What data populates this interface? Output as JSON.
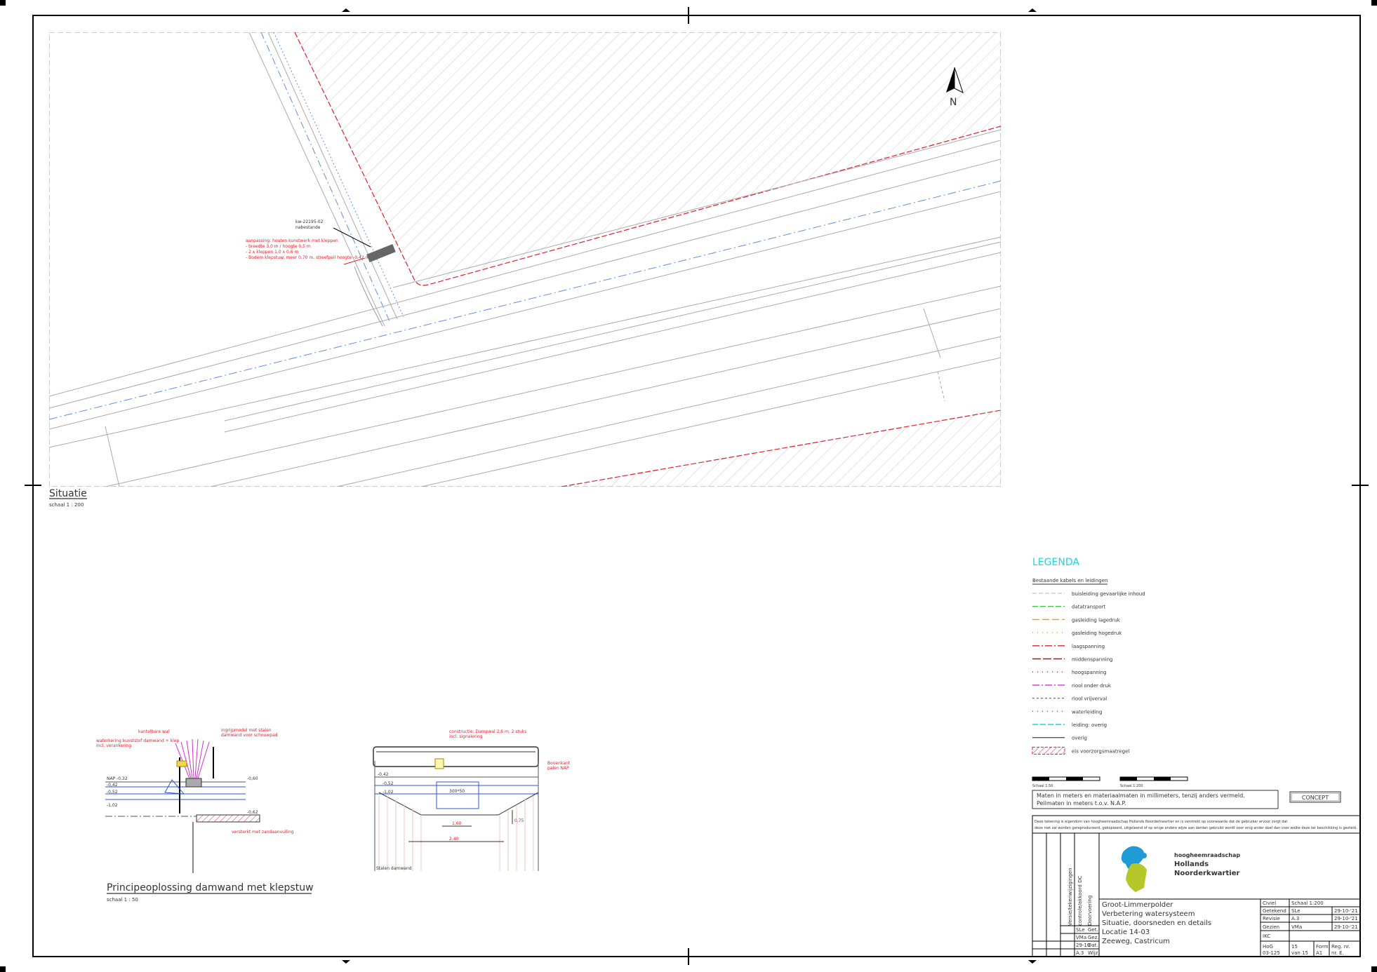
{
  "situation": {
    "title": "Situatie",
    "scale": "schaal 1 : 200",
    "north": "N",
    "callout_black": [
      "kw-22195-02",
      "nabestande"
    ],
    "callout_red": [
      "aanpassing: houten kunstwerk met kleppen",
      "- breedte 3,0 m / hoogte 0,5 m",
      "- 2 x kleppen 1,0 x 0,6 m",
      "- Bodem klepstuw: meer 0,70 m, streefpeil hoogte -0,42 m"
    ]
  },
  "detail": {
    "title": "Principeoplossing damwand met klepstuw",
    "scale": "schaal 1 : 50",
    "left_labels_red": [
      "kantelbare wal",
      "waterkering kunststof damwand + klep",
      "incl. verankering",
      "ingrijpmodel met stalen",
      "damwand voor schouwpad",
      "versterkt met zandaanvulling"
    ],
    "left_levels": [
      "NAP -0,32",
      "-0,42",
      "-0,52",
      "-1,02",
      "-0,60",
      "-0,62"
    ],
    "right_labels_red": [
      "constructie: Dampwal 2,6 m, 2 stuks",
      "incl. signalering",
      "Bovenkant",
      "palen NAP"
    ],
    "right_dims": [
      "300*50",
      "1,60",
      "2,40",
      "0,75",
      "Stalen damwand"
    ],
    "right_levels": [
      "-0,42",
      "-0,52",
      "-1,02"
    ]
  },
  "legend": {
    "title": "LEGENDA",
    "subtitle": "Bestaande kabels en leidingen",
    "items": [
      {
        "label": "buisleiding gevaarlijke inhoud",
        "color": "#cfcfcf",
        "dash": "6 3"
      },
      {
        "label": "datatransport",
        "color": "#3ccf3c",
        "dash": "8 3"
      },
      {
        "label": "gasleiding lagedruk",
        "color": "#e7a400",
        "dash": "10 4"
      },
      {
        "label": "gasleiding hogedruk",
        "color": "#e7a400",
        "dash": "1 6"
      },
      {
        "label": "laagspanning",
        "color": "#e0212d",
        "dash": "10 3 2 3"
      },
      {
        "label": "middenspanning",
        "color": "#b3131c",
        "dash": "12 3"
      },
      {
        "label": "hoogspanning",
        "color": "#b3131c",
        "dash": "1 6"
      },
      {
        "label": "riool onder druk",
        "color": "#cc33cc",
        "dash": "10 3 2 3"
      },
      {
        "label": "riool vrijverval",
        "color": "#cc33cc",
        "dash": "3 3"
      },
      {
        "label": "waterleiding",
        "color": "#2b55d6",
        "dash": "1 6"
      },
      {
        "label": "leiding: overig",
        "color": "#1fd3df",
        "dash": "8 3"
      },
      {
        "label": "overig",
        "color": "#555555",
        "dash": ""
      },
      {
        "label": "eis voorzorgsmaatregel",
        "color": "#e0212d",
        "dash": "hatch"
      }
    ],
    "scalebar1": "Schaal 1:50",
    "scalebar2": "Schaal 1:200",
    "note_lines": [
      "Maten in meters en materiaalmaten in millimeters, tenzij anders vermeld.",
      "Peilmaten in meters t.o.v. N.A.P."
    ],
    "status_box": "CONCEPT"
  },
  "titleblock": {
    "disclaimer_lines": [
      "Deze tekening is eigendom van hoogheemraadschap Hollands Noorderkwartier en is verstrekt op voorwaarde dat de gebruiker ervoor zorgt dat",
      "deze niet zal worden gereproduceerd, gekopieerd, uitgeleend of op enige andere wijze aan derden gebruikt wordt voor enig ander doel dan voor welke deze ter beschikking is gesteld."
    ],
    "vertical_labels": [
      "Versie/tekenwijzigingen",
      "controle/akkoord DC",
      "Doorvoering"
    ],
    "org_line1": "hoogheemraadschap",
    "org_line2": "Hollands",
    "org_line3": "Noorderkwartier",
    "project_lines": [
      "Groot-Limmerpolder",
      "Verbetering watersysteem",
      "Situatie, doorsneden en details",
      "Locatie 14-03",
      "Zeeweg, Castricum"
    ],
    "left_cells": [
      "SLe",
      "Get.",
      "VMa",
      "Gez.",
      "29-10",
      "Dat.",
      "A.3",
      "Wijz."
    ],
    "fields": [
      {
        "k": "Civiel",
        "v": "Schaal 1:200",
        "d": ""
      },
      {
        "k": "Getekend",
        "v": "SLe",
        "d": "29-10-'21"
      },
      {
        "k": "Revisie",
        "v": "A.3",
        "d": "29-10-'21"
      },
      {
        "k": "Gezien",
        "v": "VMa",
        "d": "29-10-'21"
      },
      {
        "k": "IKC",
        "v": "",
        "d": ""
      }
    ],
    "bottom": {
      "hoge": "HoG",
      "hoge_no": "03-125",
      "sheet": "15",
      "sheet_of": "van 15",
      "form": "Form.",
      "form_v": "A1",
      "reg": "Reg. nr.",
      "reg_v": "nr. E."
    }
  }
}
